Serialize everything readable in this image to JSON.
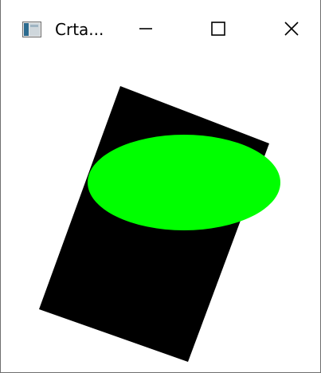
{
  "window": {
    "title": "Crta...",
    "app_icon": "window-app-icon",
    "controls": {
      "minimize_icon": "minimize-icon",
      "maximize_icon": "maximize-icon",
      "close_icon": "close-icon"
    }
  },
  "canvas": {
    "shapes": [
      {
        "kind": "rotated-rectangle",
        "fill": "#000000"
      },
      {
        "kind": "ellipse",
        "fill": "#00ff00"
      }
    ]
  }
}
